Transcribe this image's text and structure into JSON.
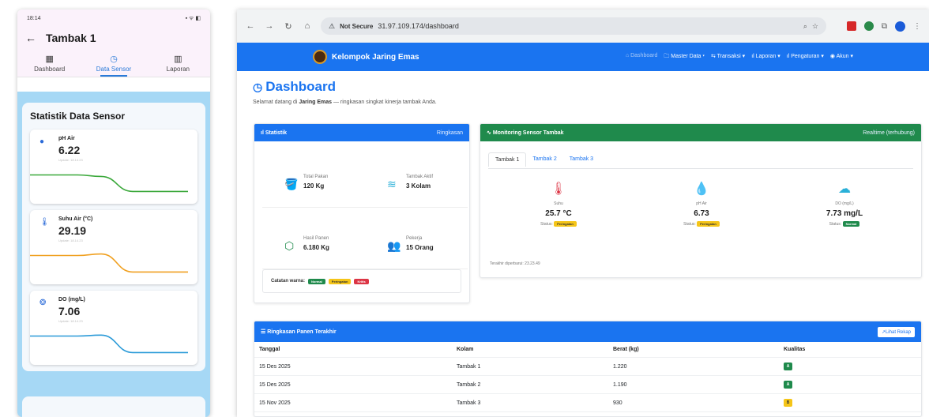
{
  "phone": {
    "status_time": "18:14",
    "status_icons": "▪ ᯤ ◧",
    "title": "Tambak 1",
    "tabs": [
      {
        "label": "Dashboard",
        "icon": "grid-icon"
      },
      {
        "label": "Data Sensor",
        "icon": "speedometer-icon"
      },
      {
        "label": "Laporan",
        "icon": "bar-chart-icon"
      }
    ],
    "active_tab": "Data Sensor",
    "panel_title": "Statistik Data Sensor",
    "sensors": [
      {
        "label": "pH Air",
        "value": "6.22",
        "updated": "Update: 18.14.23",
        "color": "#3aa83a",
        "icon": "ph-drop-icon",
        "trend": [
          0.75,
          0.75,
          0.7,
          0.2,
          0.2
        ]
      },
      {
        "label": "Suhu Air (°C)",
        "value": "29.19",
        "updated": "Update: 18.14.23",
        "color": "#f0a020",
        "icon": "thermometer-icon",
        "trend": [
          0.75,
          0.75,
          0.8,
          0.2,
          0.2
        ]
      },
      {
        "label": "DO (mg/L)",
        "value": "7.06",
        "updated": "Update: 18.14.23",
        "color": "#2a9ad8",
        "icon": "oxygen-icon",
        "trend": [
          0.75,
          0.75,
          0.78,
          0.2,
          0.2
        ]
      }
    ]
  },
  "browser": {
    "security_label": "Not Secure",
    "url": "31.97.109.174/dashboard",
    "brand": "Kelompok Jaring Emas",
    "nav": [
      {
        "label": "⌂ Dashboard",
        "dim": true
      },
      {
        "label": "🗀 Master Data ▾",
        "dim": false
      },
      {
        "label": "⇆ Transaksi ▾",
        "dim": false
      },
      {
        "label": "ıl Laporan ▾",
        "dim": false
      },
      {
        "label": "ıl Pengaturan ▾",
        "dim": false
      },
      {
        "label": "◉ Akun ▾",
        "dim": false
      }
    ]
  },
  "page": {
    "title": "Dashboard",
    "subtitle_pre": "Selamat datang di ",
    "subtitle_bold": "Jaring Emas",
    "subtitle_post": " — ringkasan singkat kinerja tambak Anda."
  },
  "statistik": {
    "header": "Statistik",
    "header_right": "Ringkasan",
    "items": [
      {
        "label": "Total Pakan",
        "value": "120 Kg",
        "icon": "bucket-icon",
        "color": "#1a74f0"
      },
      {
        "label": "Tambak Aktif",
        "value": "3 Kolam",
        "icon": "water-icon",
        "color": "#2ab0d8"
      },
      {
        "label": "Hasil Panen",
        "value": "6.180 Kg",
        "icon": "box-icon",
        "color": "#1f8a4c"
      },
      {
        "label": "Pekerja",
        "value": "15 Orang",
        "icon": "people-icon",
        "color": "#f0a020"
      }
    ],
    "legend_label": "Catatan warna:",
    "legend": [
      "Normal",
      "Peringatan",
      "Kritis"
    ]
  },
  "monitoring": {
    "header": "Monitoring Sensor Tambak",
    "header_right": "Realtime (terhubung)",
    "tabs": [
      "Tambak 1",
      "Tambak 2",
      "Tambak 3"
    ],
    "active_tab": "Tambak 1",
    "sensors": [
      {
        "name": "Suhu",
        "value": "25.7 °C",
        "status_label": "Status:",
        "status": "Peringatan",
        "icon": "thermometer-icon",
        "color": "#dc3545"
      },
      {
        "name": "pH Air",
        "value": "6.73",
        "status_label": "Status:",
        "status": "Peringatan",
        "icon": "droplet-icon",
        "color": "#1a74f0"
      },
      {
        "name": "DO (mg/L)",
        "value": "7.73 mg/L",
        "status_label": "Status:",
        "status": "Normal",
        "icon": "cloud-rain-icon",
        "color": "#2ab0d8"
      }
    ],
    "updated": "Terakhir diperbarui: 23.23.49"
  },
  "panen": {
    "header": "Ringkasan Panen Terakhir",
    "button": "Lihat Rekap",
    "columns": [
      "Tanggal",
      "Kolam",
      "Berat (kg)",
      "Kualitas"
    ],
    "rows": [
      {
        "tanggal": "15 Des 2025",
        "kolam": "Tambak 1",
        "berat": "1.220",
        "kualitas": "A"
      },
      {
        "tanggal": "15 Des 2025",
        "kolam": "Tambak 2",
        "berat": "1.190",
        "kualitas": "A"
      },
      {
        "tanggal": "15 Nov 2025",
        "kolam": "Tambak 3",
        "berat": "930",
        "kualitas": "B"
      }
    ]
  }
}
